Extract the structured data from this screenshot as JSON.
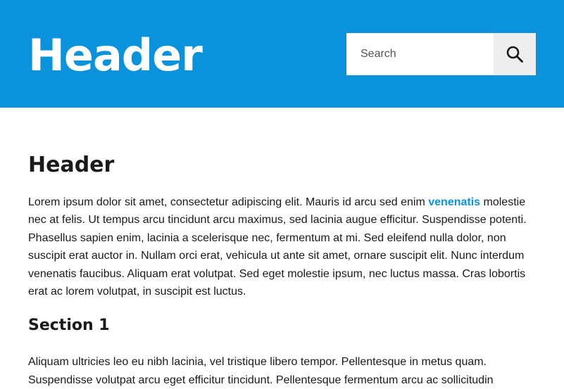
{
  "header": {
    "title": "Header",
    "background_color": "#0a93dc",
    "search": {
      "placeholder": "Search",
      "value": "",
      "button_icon": "search-icon"
    }
  },
  "main": {
    "title": "Header",
    "paragraph_1": {
      "before_link": "Lorem ipsum dolor sit amet, consectetur adipiscing elit. Mauris id arcu sed enim ",
      "link_text": "venenatis",
      "after_link": " molestie nec at felis. Ut tempus arcu tincidunt arcu maximus, sed lacinia augue efficitur. Suspendisse potenti. Phasellus sapien enim, lacinia a scelerisque nec, fermentum at mi. Sed eleifend nulla dolor, non suscipit erat auctor in. Nullam orci erat, vehicula ut ante sit amet, ornare suscipit elit. Nunc interdum venenatis faucibus. Aliquam erat volutpat. Sed eget molestie ipsum, nec luctus massa. Cras lobortis erat ac lorem volutpat, in suscipit est luctus."
    },
    "section_1": {
      "title": "Section 1",
      "paragraph": "Aliquam ultricies leo eu nibh lacinia, vel tristique libero tempor. Pellentesque in metus quam. Suspendisse volutpat arcu eget efficitur tincidunt. Pellentesque fermentum arcu ac sollicitudin"
    },
    "link_color": "#0a93dc",
    "text_color": "#1a1a1a"
  }
}
